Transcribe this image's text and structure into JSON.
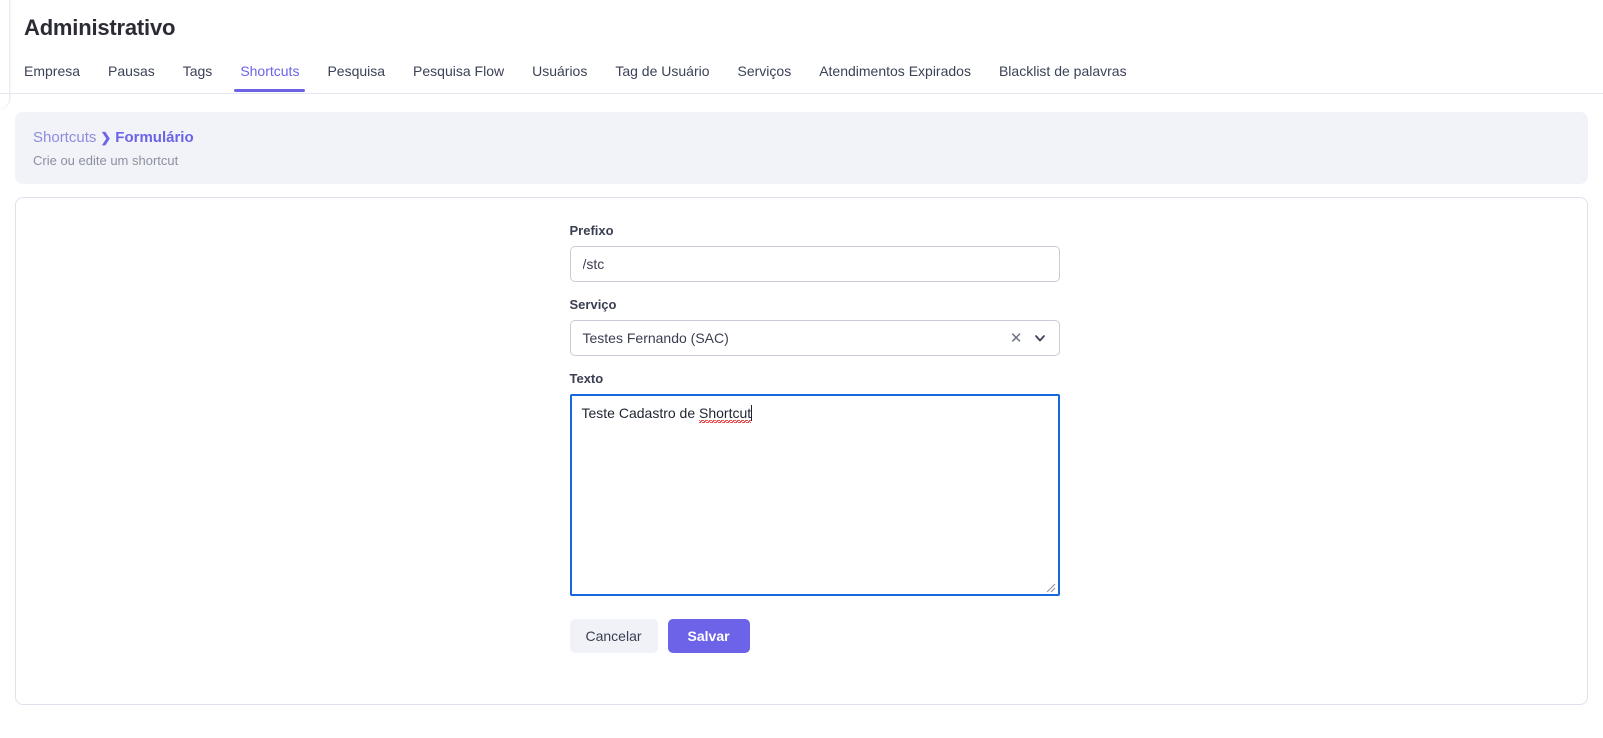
{
  "header": {
    "title": "Administrativo"
  },
  "tabs": [
    {
      "label": "Empresa",
      "active": false
    },
    {
      "label": "Pausas",
      "active": false
    },
    {
      "label": "Tags",
      "active": false
    },
    {
      "label": "Shortcuts",
      "active": true
    },
    {
      "label": "Pesquisa",
      "active": false
    },
    {
      "label": "Pesquisa Flow",
      "active": false
    },
    {
      "label": "Usuários",
      "active": false
    },
    {
      "label": "Tag de Usuário",
      "active": false
    },
    {
      "label": "Serviços",
      "active": false
    },
    {
      "label": "Atendimentos Expirados",
      "active": false
    },
    {
      "label": "Blacklist de palavras",
      "active": false
    }
  ],
  "breadcrumb": {
    "parent": "Shortcuts",
    "separator": "❯",
    "current": "Formulário",
    "subtitle": "Crie ou edite um shortcut"
  },
  "form": {
    "prefixo": {
      "label": "Prefixo",
      "value": "/stc",
      "placeholder": ""
    },
    "servico": {
      "label": "Serviço",
      "value": "Testes Fernando (SAC)",
      "clear_icon": "close-icon",
      "chevron_icon": "chevron-down-icon"
    },
    "texto": {
      "label": "Texto",
      "value_prefix": "Teste Cadastro de ",
      "value_misspelled": "Shortcut",
      "focused": true
    }
  },
  "actions": {
    "cancel_label": "Cancelar",
    "save_label": "Salvar"
  },
  "colors": {
    "accent": "#6c63e8",
    "panel_bg": "#f1f3f8",
    "focus_border": "#1668dd",
    "spellcheck": "#e01b1b",
    "cancel_bg": "#f0f2f7"
  }
}
